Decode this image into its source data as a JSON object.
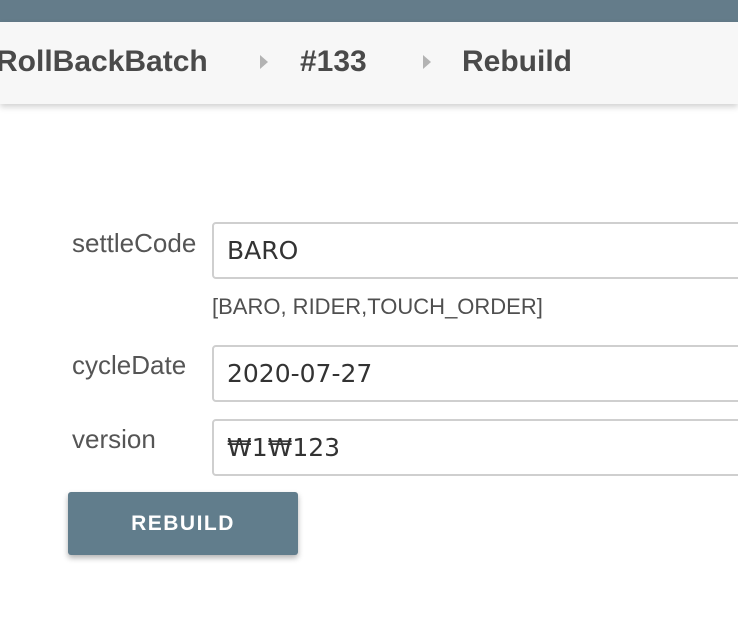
{
  "breadcrumb": {
    "items": [
      "tRollBackBatch",
      "#133",
      "Rebuild"
    ]
  },
  "form": {
    "settleCode": {
      "label": "settleCode",
      "value": "BARO",
      "hint": "[BARO, RIDER,TOUCH_ORDER]"
    },
    "cycleDate": {
      "label": "cycleDate",
      "value": "2020-07-27"
    },
    "version": {
      "label": "version",
      "value": "₩1₩123"
    }
  },
  "actions": {
    "rebuild_label": "REBUILD"
  },
  "colors": {
    "header": "#647c8a",
    "button": "#617d8c",
    "breadcrumb_bg": "#f7f7f7"
  }
}
